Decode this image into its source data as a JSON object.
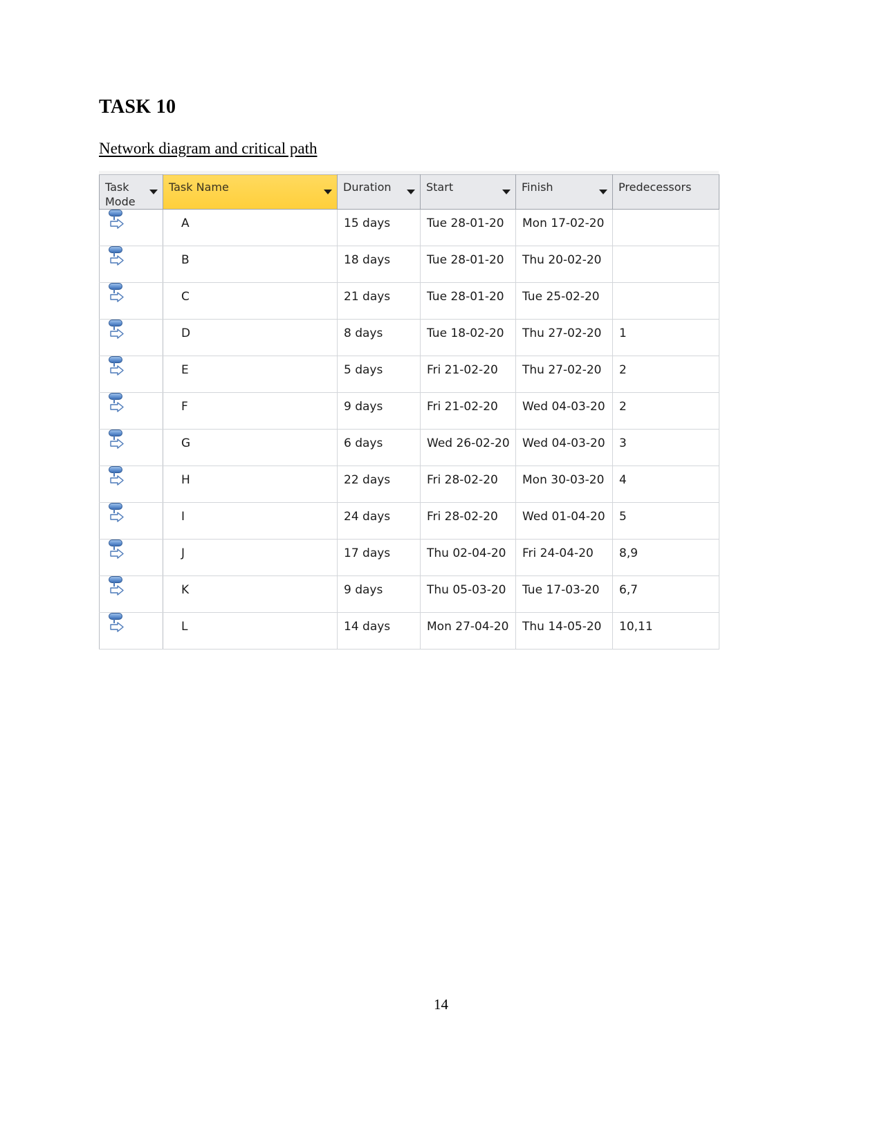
{
  "document": {
    "title": "TASK 10",
    "subtitle": "Network diagram and critical path",
    "page_number": "14"
  },
  "grid": {
    "columns": [
      {
        "key": "mode",
        "label": "Task\nMode",
        "highlighted": false,
        "has_filter": true
      },
      {
        "key": "name",
        "label": "Task Name",
        "highlighted": true,
        "has_filter": true
      },
      {
        "key": "duration",
        "label": "Duration",
        "highlighted": false,
        "has_filter": true
      },
      {
        "key": "start",
        "label": "Start",
        "highlighted": false,
        "has_filter": true
      },
      {
        "key": "finish",
        "label": "Finish",
        "highlighted": false,
        "has_filter": true
      },
      {
        "key": "pred",
        "label": "Predecessors",
        "highlighted": false,
        "has_filter": false
      }
    ],
    "highlight_color": "#ffd44a",
    "header_background": "#e8e9ec",
    "mode_icon": "auto-scheduled-icon",
    "rows": [
      {
        "mode": "auto-scheduled-icon",
        "name": "A",
        "duration": "15 days",
        "start": "Tue 28-01-20",
        "finish": "Mon 17-02-20",
        "pred": ""
      },
      {
        "mode": "auto-scheduled-icon",
        "name": "B",
        "duration": "18 days",
        "start": "Tue 28-01-20",
        "finish": "Thu 20-02-20",
        "pred": ""
      },
      {
        "mode": "auto-scheduled-icon",
        "name": "C",
        "duration": "21 days",
        "start": "Tue 28-01-20",
        "finish": "Tue 25-02-20",
        "pred": ""
      },
      {
        "mode": "auto-scheduled-icon",
        "name": "D",
        "duration": "8 days",
        "start": "Tue 18-02-20",
        "finish": "Thu 27-02-20",
        "pred": "1"
      },
      {
        "mode": "auto-scheduled-icon",
        "name": "E",
        "duration": "5 days",
        "start": "Fri 21-02-20",
        "finish": "Thu 27-02-20",
        "pred": "2"
      },
      {
        "mode": "auto-scheduled-icon",
        "name": "F",
        "duration": "9 days",
        "start": "Fri 21-02-20",
        "finish": "Wed 04-03-20",
        "pred": "2"
      },
      {
        "mode": "auto-scheduled-icon",
        "name": "G",
        "duration": "6 days",
        "start": "Wed 26-02-20",
        "finish": "Wed 04-03-20",
        "pred": "3"
      },
      {
        "mode": "auto-scheduled-icon",
        "name": "H",
        "duration": "22 days",
        "start": "Fri 28-02-20",
        "finish": "Mon 30-03-20",
        "pred": "4"
      },
      {
        "mode": "auto-scheduled-icon",
        "name": "I",
        "duration": "24 days",
        "start": "Fri 28-02-20",
        "finish": "Wed 01-04-20",
        "pred": "5"
      },
      {
        "mode": "auto-scheduled-icon",
        "name": "J",
        "duration": "17 days",
        "start": "Thu 02-04-20",
        "finish": "Fri 24-04-20",
        "pred": "8,9"
      },
      {
        "mode": "auto-scheduled-icon",
        "name": "K",
        "duration": "9 days",
        "start": "Thu 05-03-20",
        "finish": "Tue 17-03-20",
        "pred": "6,7"
      },
      {
        "mode": "auto-scheduled-icon",
        "name": "L",
        "duration": "14 days",
        "start": "Mon 27-04-20",
        "finish": "Thu 14-05-20",
        "pred": "10,11"
      }
    ]
  }
}
